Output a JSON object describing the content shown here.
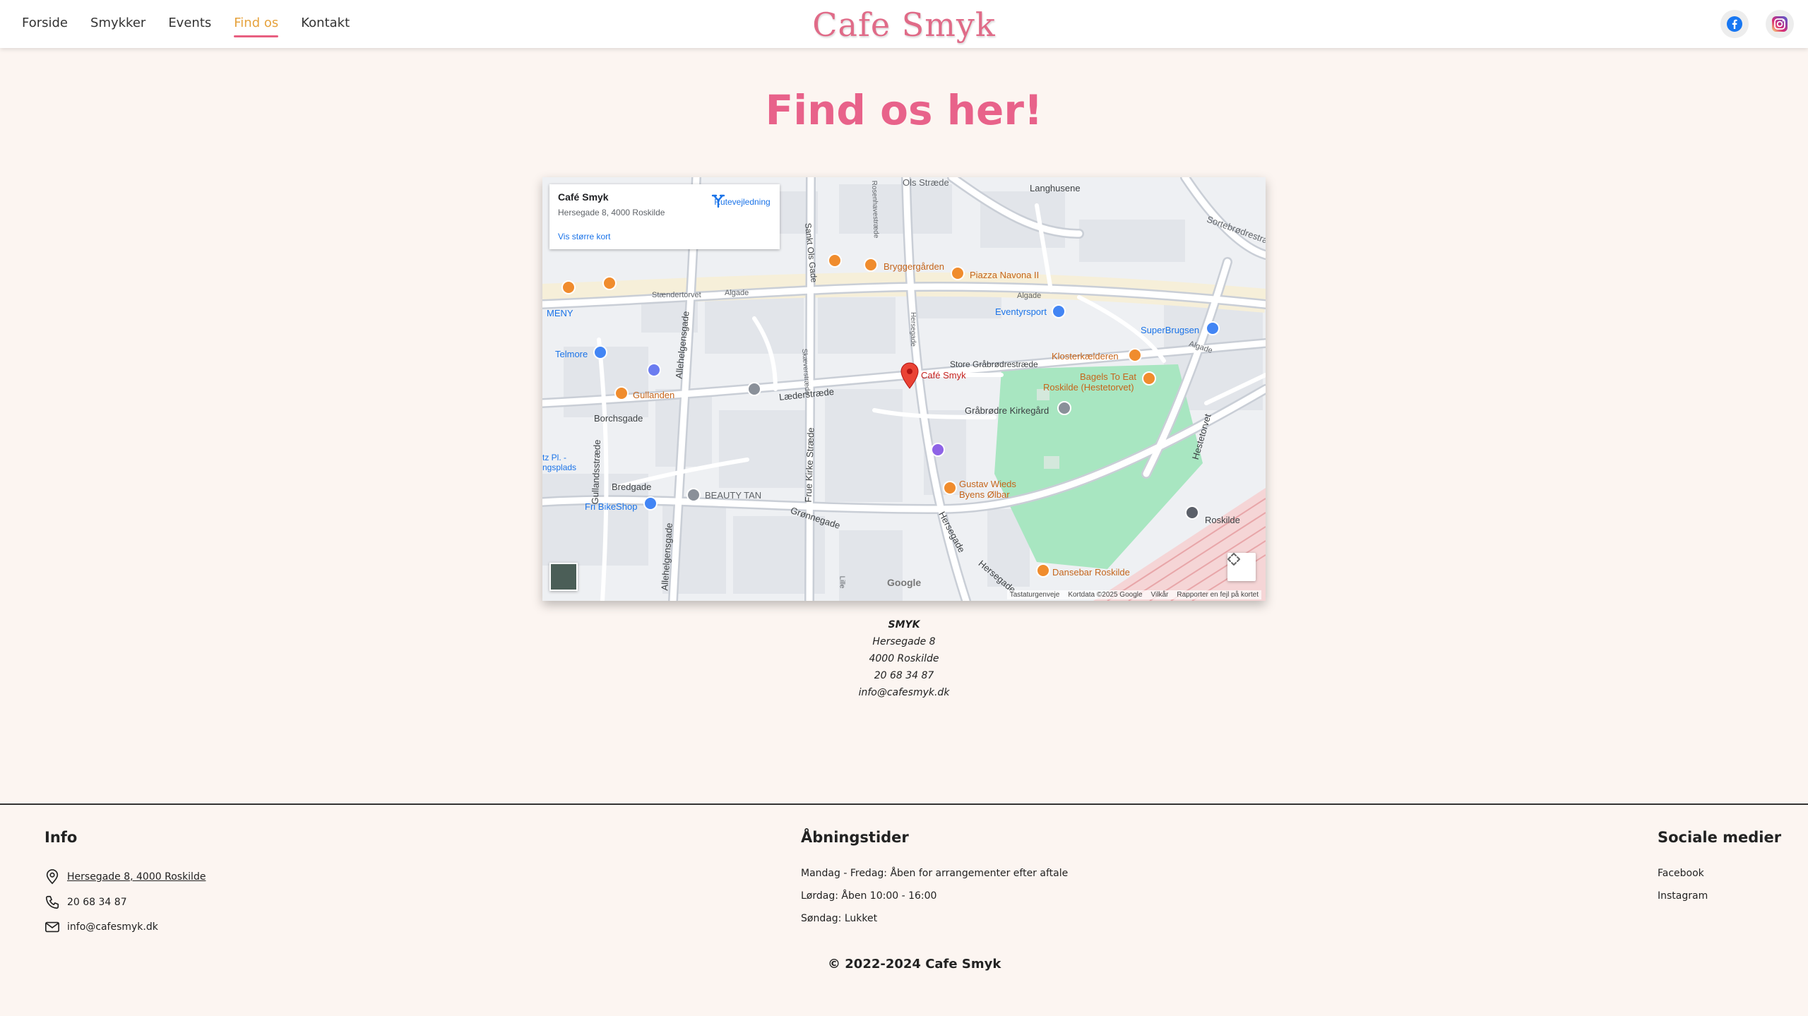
{
  "header": {
    "nav": [
      {
        "label": "Forside"
      },
      {
        "label": "Smykker"
      },
      {
        "label": "Events"
      },
      {
        "label": "Find os"
      },
      {
        "label": "Kontakt"
      }
    ],
    "brand": "Cafe Smyk",
    "social": [
      {
        "icon": "facebook-icon",
        "color": "#1877f2"
      },
      {
        "icon": "instagram-icon",
        "color": "#d62976"
      }
    ]
  },
  "main": {
    "title": "Find os her!"
  },
  "map": {
    "card": {
      "name": "Café Smyk",
      "address": "Hersegade 8, 4000 Roskilde",
      "directions": "Rutevejledning",
      "larger_map": "Vis større kort"
    },
    "labels": {
      "ols_straede": "Ols Stræde",
      "langhusene": "Langhusene",
      "sortebrodrestraede": "Sortebrødrestræde",
      "bryggergaarden": "Bryggergården",
      "piazza": "Piazza Navona II",
      "staendertorvet": "Stændertorvet",
      "algade_1": "Algade",
      "algade_2": "Algade",
      "algade_3": "Algade",
      "meny": "MENY",
      "eventyrsport": "Eventyrsport",
      "superbrugsen": "SuperBrugsen",
      "telmore": "Telmore",
      "klosterkaelderen": "Klosterkælderen",
      "store_graabroedre": "Store Gråbrødrestræde",
      "bagels": "Bagels To Eat",
      "bagels_sub": "Roskilde (Hestetorvet)",
      "cafe_smyk": "Café Smyk",
      "gullanden": "Gullanden",
      "laederstraede": "Læderstræde",
      "graabroedre_kirkegaard": "Gråbrødre Kirkegård",
      "borchsgade": "Borchsgade",
      "hestetorvet": "Hestetorvet",
      "bredgade": "Bredgade",
      "beauty_tan": "BEAUTY TAN",
      "gustav_1": "Gustav Wieds",
      "gustav_2": "Byens Ølbar",
      "fri_bikeshop": "Fri BikeShop",
      "groennegade": "Grønnegade",
      "roskilde": "Roskilde",
      "hersegade_1": "Hersegade",
      "hersegade_2": "Hersegade",
      "dansebar": "Dansebar Roskilde",
      "allehelgensgade_1": "Allehelgensgade",
      "allehelgensgade_2": "Allehelgensgade",
      "gullandsstraede": "Gullandsstræde",
      "sankt_ols_gade": "Sankt Ols Gade",
      "frue_kirke": "Frue Kirke Stræde",
      "skaeverstraede": "Skæverstræde",
      "rosenhavestraede": "Rosenhavestræde",
      "hersegade_small": "Hersegade",
      "parkering": "tz Pl. - ngsplads",
      "lille": "Lille",
      "google": "Google"
    },
    "attribution": {
      "keyboard": "Tastaturgenveje",
      "mapdata": "Kortdata ©2025 Google",
      "terms": "Vilkår",
      "report": "Rapporter en fejl på kortet"
    }
  },
  "address": {
    "name": "SMYK",
    "street": "Hersegade 8",
    "city": "4000 Roskilde",
    "phone": "20 68 34 87",
    "email": "info@cafesmyk.dk"
  },
  "footer": {
    "info": {
      "heading": "Info",
      "address": "Hersegade 8, 4000 Roskilde",
      "phone": "20 68 34 87",
      "email": "info@cafesmyk.dk"
    },
    "hours": {
      "heading": "Åbningstider",
      "weekdays": "Mandag - Fredag: Åben for arrangementer efter aftale",
      "saturday": "Lørdag: Åben 10:00 - 16:00",
      "sunday": "Søndag: Lukket"
    },
    "social": {
      "heading": "Sociale medier",
      "facebook": "Facebook",
      "instagram": "Instagram"
    },
    "copyright": "© 2022-2024 Cafe Smyk"
  },
  "colors": {
    "background": "#fcf5f1",
    "accent_pink": "#e8628a",
    "active_nav": "#e6a23c"
  }
}
